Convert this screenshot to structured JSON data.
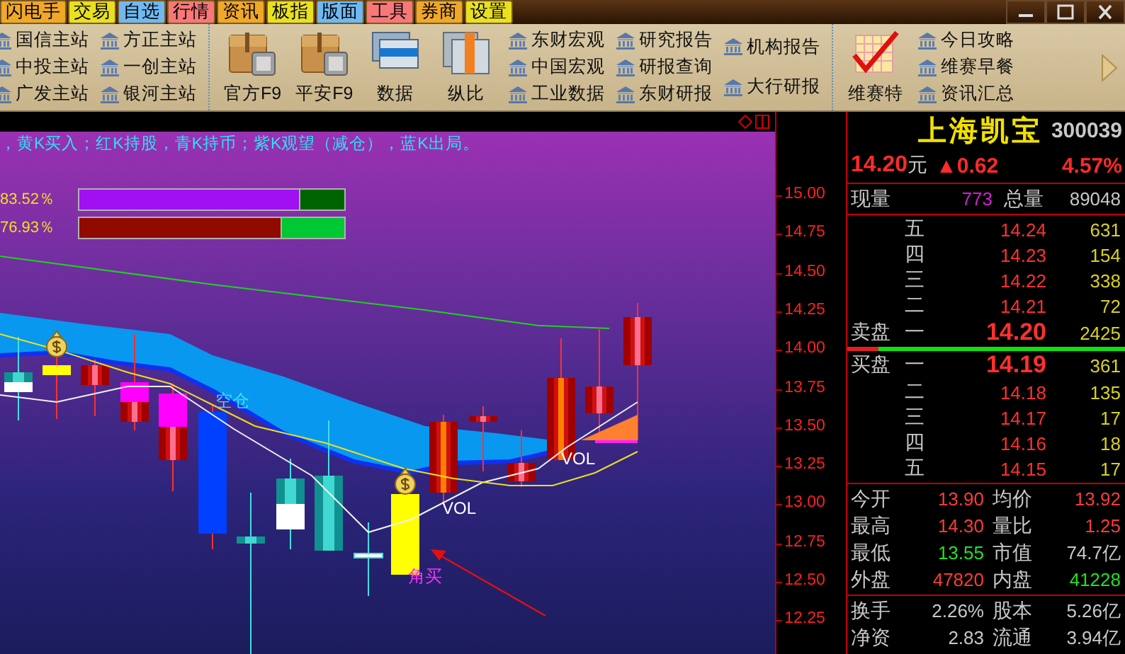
{
  "menu": [
    {
      "label": "闪电手",
      "color": "#f0a828"
    },
    {
      "label": "交易",
      "color": "#e8e020"
    },
    {
      "label": "自选",
      "color": "#70b8f0"
    },
    {
      "label": "行情",
      "color": "#f87878"
    },
    {
      "label": "资讯",
      "color": "#f0a828"
    },
    {
      "label": "板指",
      "color": "#e8e020"
    },
    {
      "label": "版面",
      "color": "#70b8f0"
    },
    {
      "label": "工具",
      "color": "#f87878"
    },
    {
      "label": "券商",
      "color": "#f0a828"
    },
    {
      "label": "设置",
      "color": "#e8e020"
    }
  ],
  "toolbar": [
    {
      "kind": "links",
      "items": [
        "国信主站",
        "中投主站",
        "广发主站"
      ]
    },
    {
      "kind": "links",
      "items": [
        "方正主站",
        "一创主站",
        "银河主站"
      ]
    },
    {
      "kind": "tools",
      "items": [
        "官方F9",
        "平安F9",
        "数据",
        "纵比"
      ]
    },
    {
      "kind": "links",
      "items": [
        "东财宏观",
        "中国宏观",
        "工业数据"
      ]
    },
    {
      "kind": "links",
      "items": [
        "研究报告",
        "研报查询",
        "东财研报"
      ]
    },
    {
      "kind": "links",
      "items": [
        "机构报告",
        "大行研报"
      ]
    },
    {
      "kind": "tools",
      "items": [
        "维赛特"
      ]
    },
    {
      "kind": "links",
      "items": [
        "今日攻略",
        "维赛早餐",
        "资讯汇总"
      ]
    }
  ],
  "chart": {
    "legend": "，黄K买入；红K持股，青K持币；紫K观望（减仓），蓝K出局。",
    "gauges": [
      {
        "reading": "83.52％",
        "level": 0.83,
        "color": "#a010f0",
        "track": {
          "color": "#006400"
        }
      },
      {
        "reading": "76.93％",
        "level": 0.76,
        "color": "#900a00",
        "track": {
          "color": "#00c832"
        }
      }
    ],
    "labels": [
      {
        "text": "空仓",
        "kind": "signal"
      },
      {
        "text": "VOL",
        "kind": "vol"
      },
      {
        "text": "VOL",
        "kind": "vol"
      },
      {
        "text": "角买",
        "kind": "buy"
      }
    ],
    "price_ticks": [
      "15.00",
      "14.75",
      "14.50",
      "14.25",
      "14.00",
      "13.75",
      "13.50",
      "13.25",
      "13.00",
      "12.75",
      "12.50",
      "12.25"
    ]
  },
  "quote": {
    "name": "上海凯宝",
    "code": "300039",
    "price": "14.20",
    "unit": "元",
    "change": "▲0.62",
    "change_pct": "4.57%",
    "volume_label": "现量",
    "volume": "773",
    "total_label": "总量",
    "total": "89048",
    "asks": [
      {
        "label": "五",
        "price": "14.24",
        "qty": "631"
      },
      {
        "label": "四",
        "price": "14.23",
        "qty": "154"
      },
      {
        "label": "三",
        "price": "14.22",
        "qty": "338"
      },
      {
        "label": "二",
        "price": "14.21",
        "qty": "72"
      },
      {
        "side_label": "卖盘",
        "label": "一",
        "price": "14.20",
        "qty": "2425"
      }
    ],
    "bids": [
      {
        "side_label": "买盘",
        "label": "一",
        "price": "14.19",
        "qty": "361"
      },
      {
        "label": "二",
        "price": "14.18",
        "qty": "135"
      },
      {
        "label": "三",
        "price": "14.17",
        "qty": "17"
      },
      {
        "label": "四",
        "price": "14.16",
        "qty": "18"
      },
      {
        "label": "五",
        "price": "14.15",
        "qty": "17"
      }
    ],
    "stats": [
      [
        {
          "label": "今开",
          "value": "13.90",
          "color": "#ff3a3a"
        },
        {
          "label": "均价",
          "value": "13.92",
          "color": "#ff3a3a"
        }
      ],
      [
        {
          "label": "最高",
          "value": "14.30",
          "color": "#ff3a3a"
        },
        {
          "label": "量比",
          "value": "1.25",
          "color": "#ff3a3a"
        }
      ],
      [
        {
          "label": "最低",
          "value": "13.55",
          "color": "#22e022"
        },
        {
          "label": "市值",
          "value": "74.7亿",
          "color": "#c8c8c8"
        }
      ],
      [
        {
          "label": "外盘",
          "value": "47820",
          "color": "#ff3a3a"
        },
        {
          "label": "内盘",
          "value": "41228",
          "color": "#22e022"
        }
      ]
    ],
    "fundamentals": [
      [
        {
          "label": "换手",
          "value": "2.26%",
          "color": "#c8c8c8"
        },
        {
          "label": "股本",
          "value": "5.26亿",
          "color": "#c8c8c8"
        }
      ],
      [
        {
          "label": "净资",
          "value": "2.83",
          "color": "#c8c8c8"
        },
        {
          "label": "流通",
          "value": "3.94亿",
          "color": "#c8c8c8"
        }
      ]
    ]
  }
}
